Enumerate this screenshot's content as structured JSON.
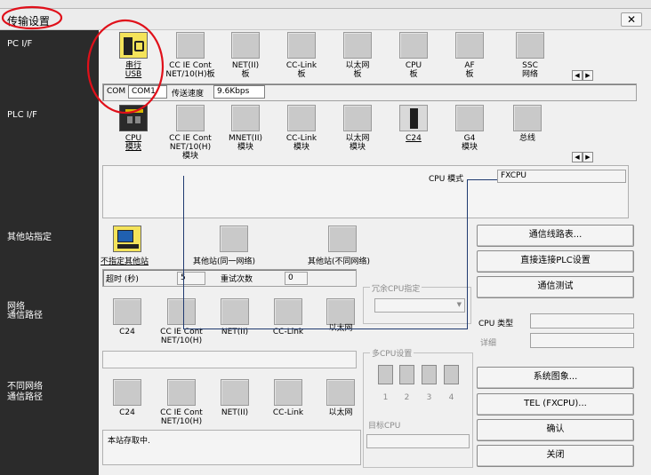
{
  "window": {
    "title": "传输设置",
    "close_glyph": "✕"
  },
  "sidebar": {
    "pc_if": "PC I/F",
    "plc_if": "PLC I/F",
    "other_station": "其他站指定",
    "network_route_1": "网络",
    "network_route_2": "通信路径",
    "diff_network_1": "不同网络",
    "diff_network_2": "通信路径"
  },
  "pc_if": {
    "items": [
      {
        "label": "串行\nUSB",
        "icon": "serial-usb-icon"
      },
      {
        "label": "CC IE Cont\nNET/10(H)板",
        "icon": "board-icon"
      },
      {
        "label": "NET(II)\n板",
        "icon": "board-icon"
      },
      {
        "label": "CC-Link\n板",
        "icon": "board-icon"
      },
      {
        "label": "以太网\n板",
        "icon": "board-icon"
      },
      {
        "label": "CPU\n板",
        "icon": "board-icon"
      },
      {
        "label": "AF\n板",
        "icon": "board-icon"
      },
      {
        "label": "SSC\n网络",
        "icon": "board-icon"
      }
    ],
    "com_label": "COM",
    "com_value": "COM1",
    "baud_label": "传送速度",
    "baud_value": "9.6Kbps"
  },
  "plc_if": {
    "items": [
      {
        "label": "CPU\n模块",
        "icon": "cpu-module-icon"
      },
      {
        "label": "CC IE Cont\nNET/10(H)\n模块",
        "icon": "module-icon"
      },
      {
        "label": "MNET(II)\n模块",
        "icon": "module-icon"
      },
      {
        "label": "CC-Link\n模块",
        "icon": "module-icon"
      },
      {
        "label": "以太网\n模块",
        "icon": "module-icon"
      },
      {
        "label": "C24",
        "icon": "c24-icon"
      },
      {
        "label": "G4\n模块",
        "icon": "module-icon"
      },
      {
        "label": "总线",
        "icon": "module-icon"
      }
    ],
    "cpu_mode_label": "CPU 模式",
    "cpu_mode_value": "FXCPU"
  },
  "other_station": {
    "items": [
      "不指定其他站",
      "其他站(同一网络)",
      "其他站(不同网络)"
    ],
    "timeout_label": "超时 (秒)",
    "timeout_value": "5",
    "retry_label": "重试次数",
    "retry_value": "0",
    "redundant_label": "冗余CPU指定"
  },
  "network_route": {
    "items": [
      "C24",
      "CC IE Cont\nNET/10(H)",
      "NET(II)",
      "CC-Link",
      "以太网"
    ]
  },
  "diff_network": {
    "items": [
      "C24",
      "CC IE Cont\nNET/10(H)",
      "NET(II)",
      "CC-Link",
      "以太网"
    ],
    "multi_cpu_label": "多CPU设置",
    "multi_cpu_numbers": [
      "1",
      "2",
      "3",
      "4"
    ],
    "target_cpu_label": "目标CPU",
    "status_text": "本站存取中."
  },
  "right_panel": {
    "btn_route_list": "通信线路表...",
    "btn_direct_plc": "直接连接PLC设置",
    "btn_comm_test": "通信测试",
    "cpu_type_label": "CPU 类型",
    "detail_label": "详细",
    "btn_system_image": "系统图象...",
    "btn_tel": "TEL (FXCPU)...",
    "btn_ok": "确认",
    "btn_close": "关闭"
  },
  "colors": {
    "annotation_red": "#e0101a",
    "sidebar_bg": "#2b2b2b",
    "connector": "#1f3a70"
  }
}
